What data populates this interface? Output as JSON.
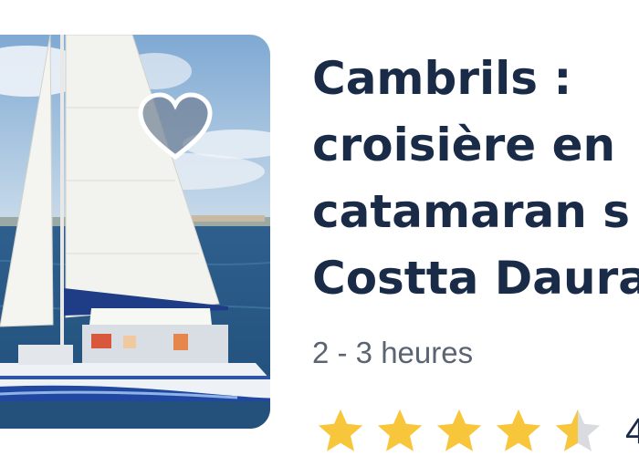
{
  "card": {
    "title_lines": [
      "Cambrils :",
      "croisière en",
      "catamaran s",
      "Costta Daura"
    ],
    "duration": "2 - 3 heures",
    "rating": {
      "value": 4.5,
      "max": 5,
      "value_label": "4"
    },
    "image": {
      "alt": "catamaran"
    },
    "favorite": {
      "icon": "heart-icon",
      "selected": false
    }
  },
  "colors": {
    "title": "#1a2b48",
    "subtitle": "#5b6472",
    "star": "#f8c63a",
    "star_empty": "#d9dbe0"
  }
}
